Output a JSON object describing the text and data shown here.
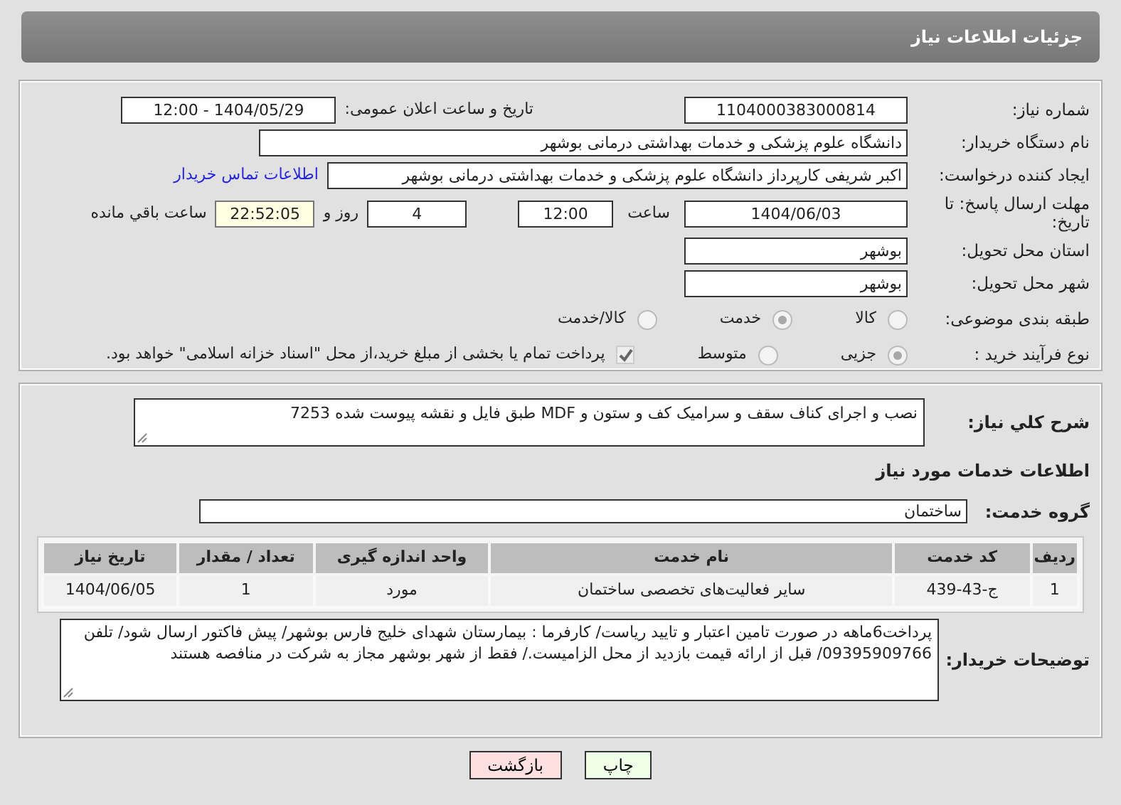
{
  "header": {
    "title": "جزئیات اطلاعات نیاز"
  },
  "need_number": {
    "label": "شماره نیاز:",
    "value": "1104000383000814"
  },
  "announce": {
    "label": "تاریخ و ساعت اعلان عمومی:",
    "value": "1404/05/29 - 12:00"
  },
  "buyer_org": {
    "label": "نام دستگاه خریدار:",
    "value": "دانشگاه علوم پزشکی و خدمات بهداشتی درمانی بوشهر"
  },
  "requester": {
    "label": "ایجاد کننده درخواست:",
    "value": "اکبر شریفی کارپرداز دانشگاه علوم پزشکی و خدمات بهداشتی درمانی بوشهر",
    "contact_link": "اطلاعات تماس خریدار"
  },
  "deadline": {
    "label": "مهلت ارسال پاسخ: تا تاریخ:",
    "date": "1404/06/03",
    "time_label": "ساعت",
    "time": "12:00",
    "days": "4",
    "days_label": "روز و",
    "remaining": "22:52:05",
    "remaining_label": "ساعت باقي مانده"
  },
  "province": {
    "label": "استان محل تحویل:",
    "value": "بوشهر"
  },
  "city": {
    "label": "شهر محل تحویل:",
    "value": "بوشهر"
  },
  "category": {
    "label": "طبقه بندی موضوعی:",
    "options": [
      {
        "label": "کالا",
        "selected": false
      },
      {
        "label": "خدمت",
        "selected": true
      },
      {
        "label": "کالا/خدمت",
        "selected": false
      }
    ]
  },
  "process": {
    "label": "نوع فرآیند خرید :",
    "options": [
      {
        "label": "جزیی",
        "selected": true
      },
      {
        "label": "متوسط",
        "selected": false
      }
    ],
    "treasury": {
      "checked": true,
      "label": "پرداخت تمام یا بخشی از مبلغ خرید،از محل \"اسناد خزانه اسلامی\" خواهد بود."
    }
  },
  "description": {
    "label": "شرح کلي نیاز:",
    "value": "نصب و اجرای کناف سقف و سرامیک کف و ستون و MDF طبق فایل و نقشه پیوست شده 7253"
  },
  "services_heading": "اطلاعات خدمات مورد نیاز",
  "service_group": {
    "label": "گروه خدمت:",
    "value": "ساختمان"
  },
  "table": {
    "columns": [
      "ردیف",
      "کد خدمت",
      "نام خدمت",
      "واحد اندازه گیری",
      "تعداد / مقدار",
      "تاریخ نیاز"
    ],
    "rows": [
      [
        "1",
        "ج-43-439",
        "سایر فعالیت‌های تخصصی ساختمان",
        "مورد",
        "1",
        "1404/06/05"
      ]
    ]
  },
  "buyer_notes": {
    "label": "توضیحات خریدار:",
    "value": "پرداخت6ماهه در صورت تامین اعتبار و تایید ریاست/ کارفرما : بیمارستان شهدای خلیج فارس بوشهر/ پیش فاکتور ارسال شود/ تلفن 09395909766/ قبل از ارائه قیمت بازدید از محل الزامیست./ فقط از شهر بوشهر مجاز به شرکت در منافصه هستند"
  },
  "buttons": [
    {
      "label": "چاپ",
      "kind": "print"
    },
    {
      "label": "بازگشت",
      "kind": "back"
    }
  ]
}
